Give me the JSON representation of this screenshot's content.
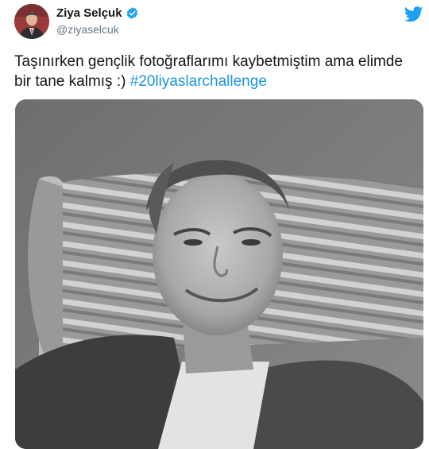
{
  "author": {
    "display_name": "Ziya Selçuk",
    "handle": "@ziyaselcuk",
    "verified_icon": "verified-badge-icon",
    "avatar_icon": "profile-avatar"
  },
  "header": {
    "brand_icon": "twitter-bird-icon"
  },
  "tweet": {
    "text": "Taşınırken gençlik fotoğraflarımı kaybetmiştim ama elimde bir tane kalmış :) ",
    "hashtag": "#20liyaslarchallenge"
  },
  "media": {
    "kind": "black-and-white portrait photo"
  },
  "colors": {
    "link": "#1b95e0",
    "twitter_blue": "#1da1f2",
    "secondary_text": "#657786"
  }
}
